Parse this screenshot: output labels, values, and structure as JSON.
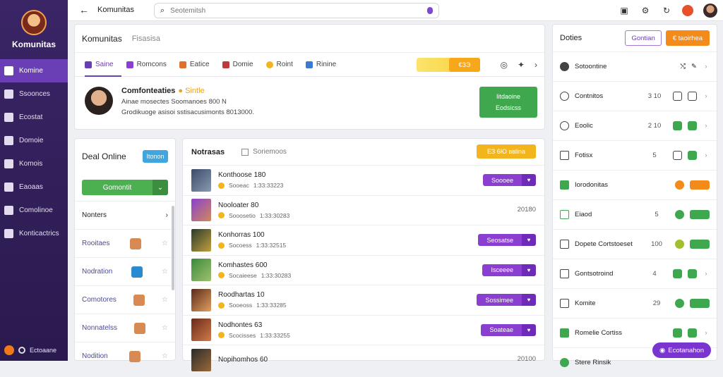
{
  "app": {
    "title": "Komunitas"
  },
  "topbar": {
    "title": "Komunitas",
    "search_placeholder": "Seotemitsh"
  },
  "nav": {
    "items": [
      {
        "label": "Komine",
        "active": true
      },
      {
        "label": "Ssoonces"
      },
      {
        "label": "Ecostat"
      },
      {
        "label": "Domoie"
      },
      {
        "label": "Komois"
      },
      {
        "label": "Eaoaas"
      },
      {
        "label": "Comolinoe"
      },
      {
        "label": "Konticactrics"
      }
    ],
    "footer_label": "Ectoaane"
  },
  "main": {
    "title": "Komunitas",
    "subtitle": "Fisasisa",
    "tabs": [
      "Saine",
      "Romcons",
      "Eatice",
      "Domie",
      "Roint",
      "Rinine"
    ],
    "promo_label": "€ЗЭ",
    "profile": {
      "name": "Comfonteaties",
      "verified_label": "Sintle",
      "line1": "Ainae mosectes Soomanoes 800 N",
      "line2": "Grodikuoge asisoi sstisacusimonts 8013000."
    },
    "green_box": {
      "line1": "Iitdaoine",
      "line2": "Eodsicss"
    }
  },
  "deals": {
    "title": "Deal Online",
    "button": "Itonon",
    "select_label": "Gomontit",
    "section_label": "Nonters",
    "rows": [
      {
        "label": "Rooitaes"
      },
      {
        "label": "Nodration"
      },
      {
        "label": "Comotores"
      },
      {
        "label": "Nonnatelss"
      },
      {
        "label": "Nodition"
      }
    ]
  },
  "notes": {
    "title": "Notrasas",
    "filter": "Soriemoos",
    "action": "ЕЗ 6Ю ввlina",
    "rows": [
      {
        "name": "Konthoose 180",
        "meta1": "Sooeac",
        "meta2": "1:33:33223",
        "action": "Soooee",
        "value": ""
      },
      {
        "name": "Nooloater 80",
        "meta1": "Sooosetio",
        "meta2": "1:33:30283",
        "action": "",
        "value": "20180"
      },
      {
        "name": "Konhorras 100",
        "meta1": "Socoess",
        "meta2": "1:33:32515",
        "action": "Seosatse",
        "value": ""
      },
      {
        "name": "Komhastes 600",
        "meta1": "Socaieese",
        "meta2": "1:33:30283",
        "action": "Isceeee",
        "value": ""
      },
      {
        "name": "Roodhartas 10",
        "meta1": "Sooeoss",
        "meta2": "1:33:33285",
        "action": "Sossimee",
        "value": ""
      },
      {
        "name": "Nodhontes 63",
        "meta1": "Scocisses",
        "meta2": "1:33:33255",
        "action": "Soateae",
        "value": ""
      },
      {
        "name": "Nopihomhos 60",
        "meta1": "",
        "meta2": "",
        "action": "",
        "value": "20100"
      }
    ]
  },
  "right": {
    "title": "Doties",
    "outline_button": "Gontian",
    "orange_button": "€ taoirhea",
    "header_row": "Sotoontine",
    "rows": [
      {
        "label": "Contnitos",
        "value": "3 10"
      },
      {
        "label": "Eoolic",
        "value": "2 10"
      },
      {
        "label": "Fotisx",
        "value": "5"
      },
      {
        "label": "Iorodonitas",
        "value": ""
      },
      {
        "label": "Eiaod",
        "value": "5"
      },
      {
        "label": "Dopete Cortstoeset",
        "value": "100"
      },
      {
        "label": "Gontsotroind",
        "value": "4"
      },
      {
        "label": "Komite",
        "value": "29"
      },
      {
        "label": "Romelie Cortiss",
        "value": ""
      },
      {
        "label": "Stere Rinsik",
        "value": ""
      }
    ],
    "chat_label": "Ecotanahon"
  }
}
